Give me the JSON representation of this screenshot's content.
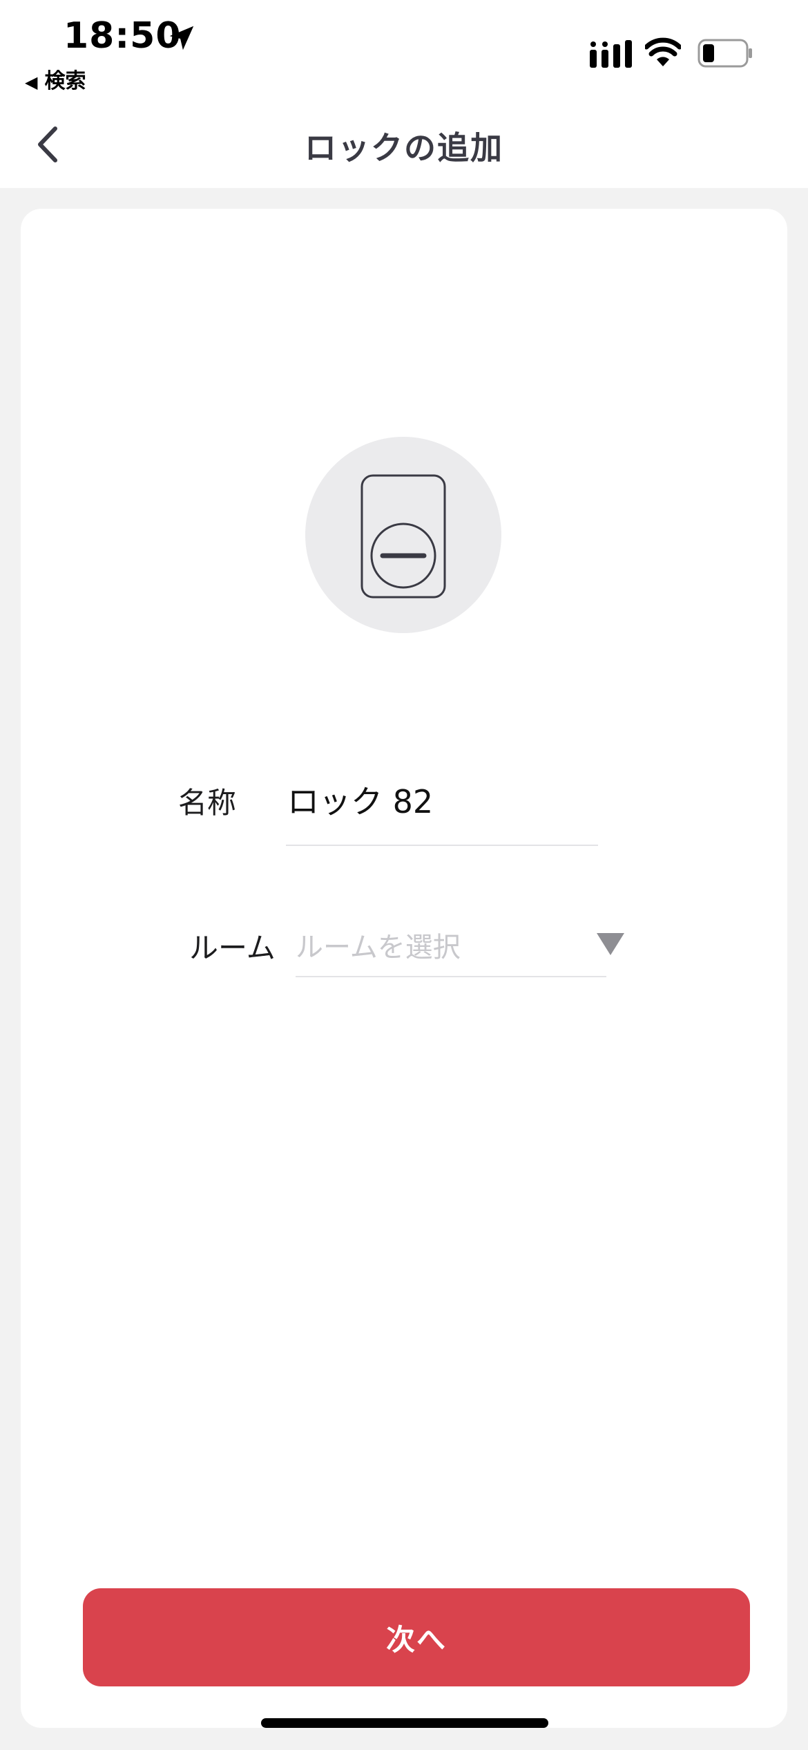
{
  "status_bar": {
    "time": "18:50",
    "back_app_label": "検索",
    "icons": [
      "location-arrow-icon",
      "cellular-signal-icon",
      "wifi-icon",
      "battery-icon"
    ]
  },
  "nav": {
    "title": "ロックの追加",
    "back_icon": "chevron-left-icon"
  },
  "device": {
    "icon": "smart-lock-icon"
  },
  "form": {
    "name_label": "名称",
    "name_value": "ロック 82",
    "room_label": "ルーム",
    "room_placeholder": "ルームを選択",
    "room_dropdown_icon": "triangle-down-icon"
  },
  "actions": {
    "next_label": "次へ"
  },
  "colors": {
    "accent": "#d9434d",
    "background": "#f2f2f2",
    "card": "#ffffff",
    "placeholder": "#c8c8cc"
  }
}
